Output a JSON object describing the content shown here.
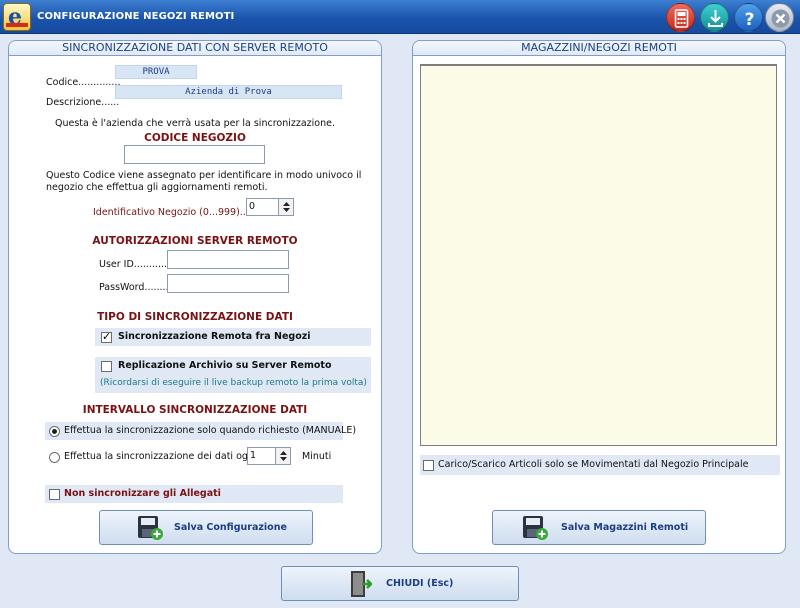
{
  "window": {
    "title": "CONFIGURAZIONE NEGOZI REMOTI"
  },
  "titlebar_icons": [
    "calculator-icon",
    "download-icon",
    "help-icon",
    "close-icon"
  ],
  "colors": {
    "title_bar": "#1b54ad",
    "section_heading": "#7a1213",
    "panel_heading": "#1b3f85",
    "list_background": "#fbfbe8"
  },
  "left_panel": {
    "title": "SINCRONIZZAZIONE DATI CON SERVER REMOTO",
    "codice_label": "Codice..............",
    "codice_value": "PROVA",
    "descrizione_label": "Descrizione......",
    "descrizione_value": "Azienda di Prova",
    "azienda_note": "Questa è l'azienda che verrà usata per la sincronizzazione.",
    "codice_negozio_heading": "CODICE NEGOZIO",
    "codice_negozio_value": "",
    "codice_note_line1": "Questo Codice viene assegnato per identificare in modo univoco il",
    "codice_note_line2": "negozio che effettua gli aggiornamenti remoti.",
    "identificativo_label": "Identificativo Negozio (0...999).......",
    "identificativo_value": "0",
    "autorizzazioni_heading": "AUTORIZZAZIONI SERVER REMOTO",
    "userid_label": "User ID............",
    "userid_value": "",
    "password_label": "PassWord........",
    "password_value": "",
    "tipo_heading": "TIPO DI SINCRONIZZAZIONE DATI",
    "sync_remota_label": "Sincronizzazione Remota fra Negozi",
    "sync_remota_checked": true,
    "replicazione_label": "Replicazione Archivio su Server Remoto",
    "replicazione_checked": false,
    "replicazione_note": "(Ricordarsi di eseguire il live backup remoto la prima volta)",
    "intervallo_heading": "INTERVALLO SINCRONIZZAZIONE DATI",
    "radio_manuale_label": "Effettua la sincronizzazione solo quando richiesto (MANUALE)",
    "radio_ogni_label": "Effettua la sincronizzazione dei dati ogni",
    "selected_interval": "manuale",
    "minuti_value": "1",
    "minuti_label": "Minuti",
    "allegati_label": "Non sincronizzare gli Allegati",
    "allegati_checked": false,
    "save_button": "Salva Configurazione"
  },
  "right_panel": {
    "title": "MAGAZZINI/NEGOZI REMOTI",
    "list_items": [],
    "carico_label": "Carico/Scarico Articoli solo se Movimentati dal Negozio Principale",
    "carico_checked": false,
    "save_button": "Salva Magazzini Remoti"
  },
  "footer": {
    "close_button": "CHIUDI  (Esc)"
  }
}
